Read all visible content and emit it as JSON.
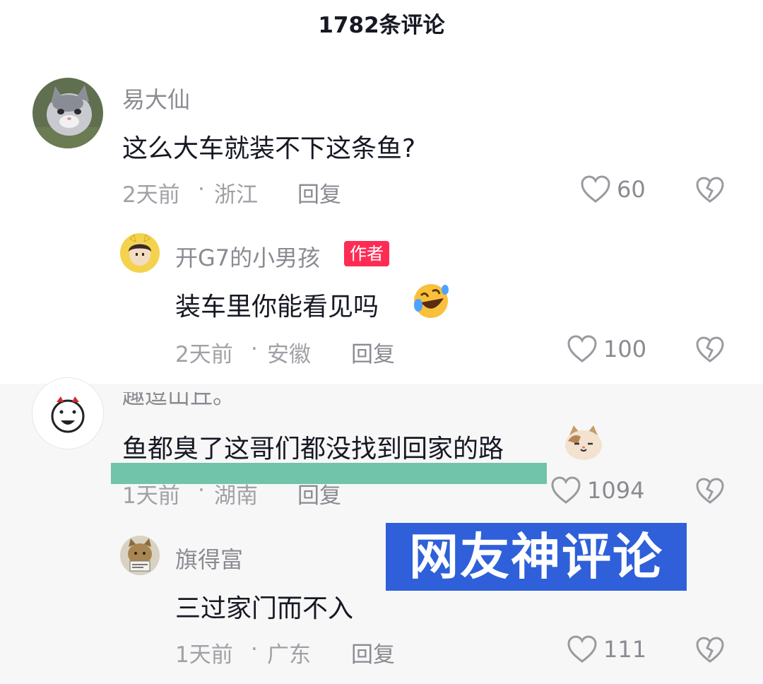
{
  "header": {
    "title": "1782条评论"
  },
  "comments": [
    {
      "username": "易大仙",
      "text": "这么大车就装不下这条鱼?",
      "time": "2天前",
      "location": "浙江",
      "reply_label": "回复",
      "likes": "60"
    },
    {
      "username": "开G7的小男孩",
      "badge": "作者",
      "text": "装车里你能看见吗",
      "time": "2天前",
      "location": "安徽",
      "reply_label": "回复",
      "likes": "100"
    },
    {
      "username": "趣逗山丘。",
      "text": "鱼都臭了这哥们都没找到回家的路",
      "time": "1天前",
      "location": "湖南",
      "reply_label": "回复",
      "likes": "1094"
    },
    {
      "username": "旗得富",
      "text": "三过家门而不入",
      "time": "1天前",
      "location": "广东",
      "reply_label": "回复",
      "likes": "111"
    }
  ],
  "overlay": {
    "text": "网友神评论"
  },
  "meta_separator": "·",
  "icons": {
    "like": "heart-outline-icon",
    "dislike": "broken-heart-icon",
    "emoji_laugh": "rolling-laughing-emoji",
    "emoji_cat": "cat-face-emoji"
  },
  "colors": {
    "badge": "#fe2c55",
    "overlay": "#2f60d9",
    "highlight": "#62bea0"
  }
}
